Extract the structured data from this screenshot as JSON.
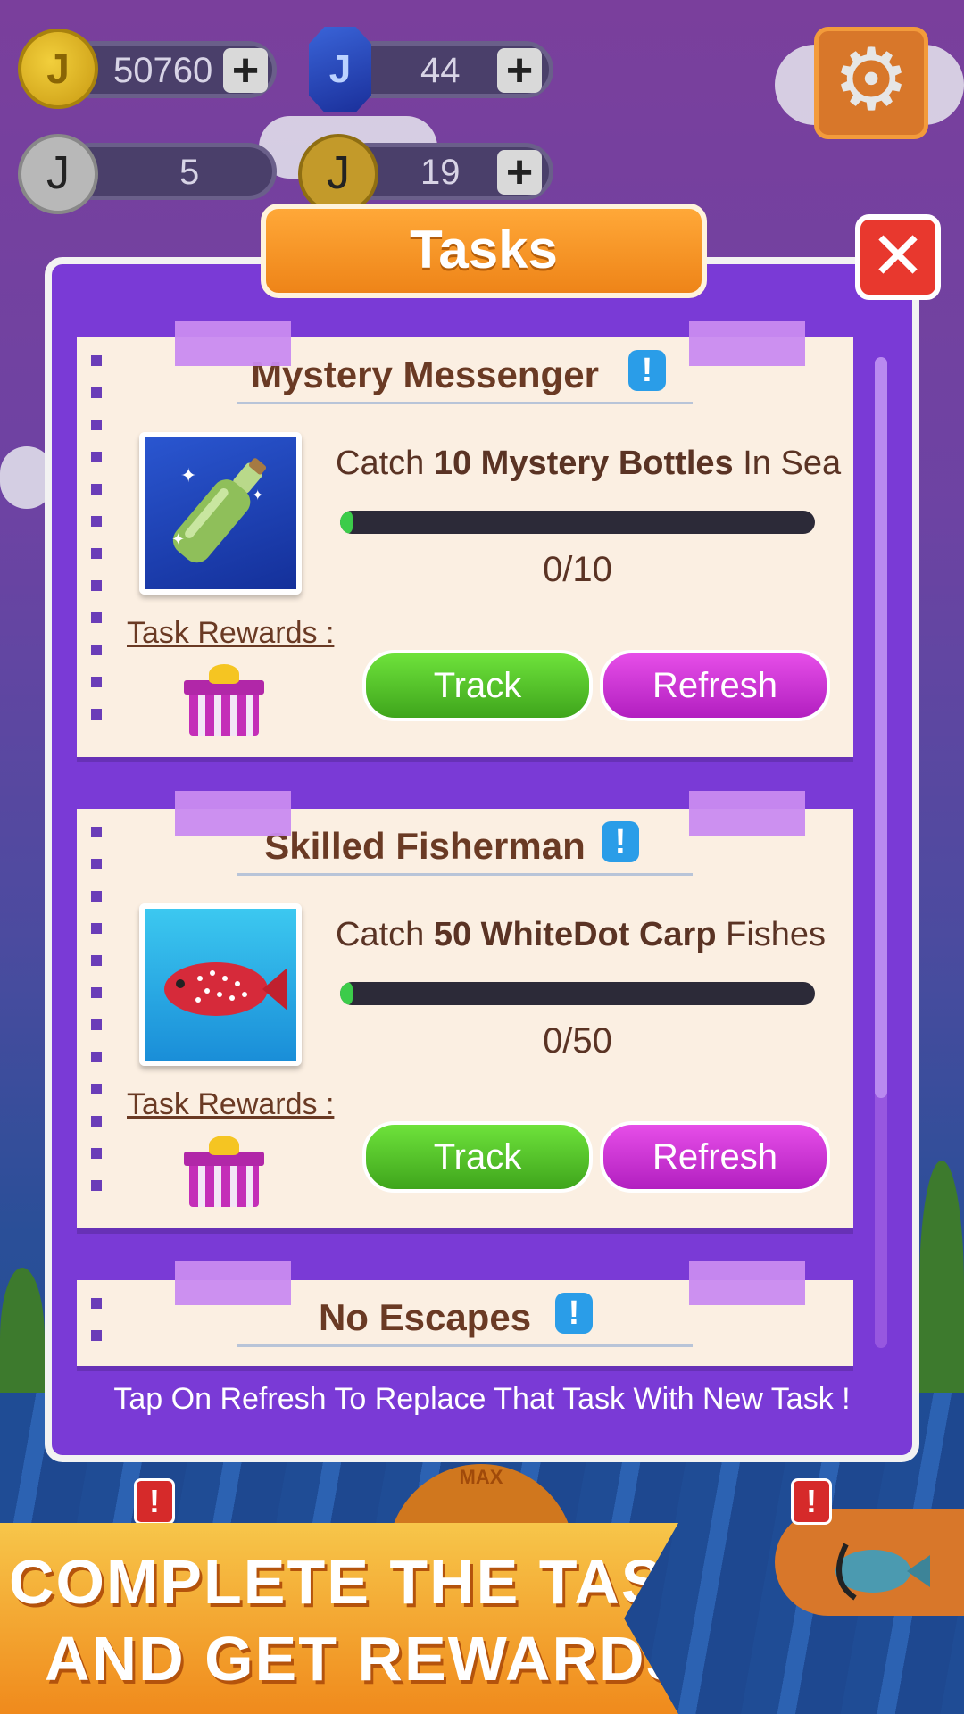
{
  "hud": {
    "coins": "50760",
    "gems": "44",
    "hooks": "5",
    "fishing_line": "19"
  },
  "panel": {
    "title": "Tasks",
    "close_glyph": "✕"
  },
  "tasks": [
    {
      "title": "Mystery Messenger",
      "objective_pre": "Catch",
      "objective_bold": "10 Mystery Bottles",
      "objective_post": "In Sea",
      "progress_text": "0/10",
      "progress_value": 0,
      "rewards_label": "Task Rewards :",
      "track_label": "Track",
      "refresh_label": "Refresh",
      "thumb_icon": "bottle-icon"
    },
    {
      "title": "Skilled Fisherman",
      "objective_pre": "Catch",
      "objective_bold": "50 WhiteDot Carp",
      "objective_post": "Fishes",
      "progress_text": "0/50",
      "progress_value": 0,
      "rewards_label": "Task Rewards :",
      "track_label": "Track",
      "refresh_label": "Refresh",
      "thumb_icon": "fish-icon"
    },
    {
      "title": "No Escapes"
    }
  ],
  "footer_note": "Tap On Refresh To Replace That Task With New Task !",
  "banner": {
    "line1": "COMPLETE THE TASKS",
    "line2": "AND GET REWARDS"
  },
  "dial_label": "MAX",
  "colors": {
    "panel": "#7a3ad6",
    "title_tab": "#ffa838",
    "track_button": "#4fbf25",
    "refresh_button": "#c72fd2",
    "close_button": "#e8382e"
  }
}
